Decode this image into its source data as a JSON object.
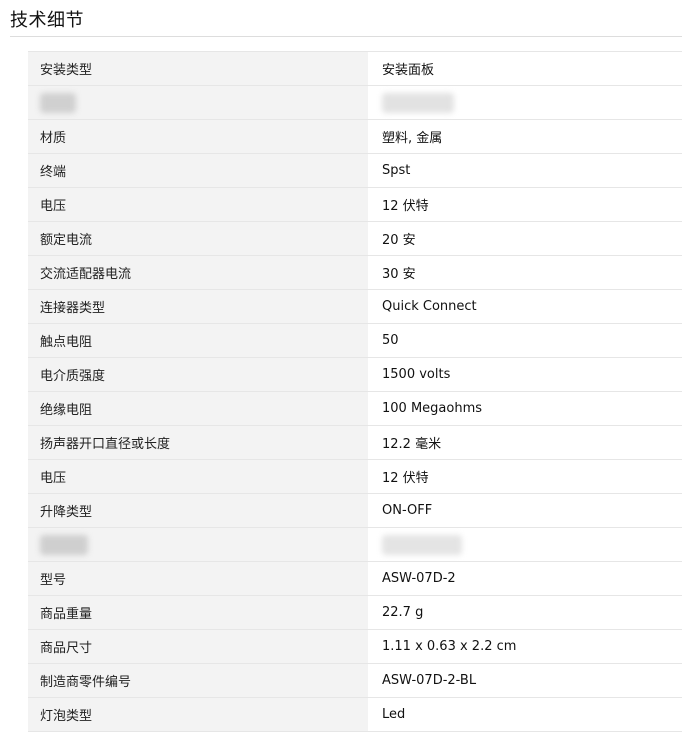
{
  "section": {
    "title": "技术细节"
  },
  "rows": [
    {
      "key": "安装类型",
      "value": "安装面板"
    },
    {
      "key": "",
      "value": "",
      "redacted": true
    },
    {
      "key": "材质",
      "value": "塑料, 金属"
    },
    {
      "key": "终端",
      "value": "Spst"
    },
    {
      "key": "电压",
      "value": "12 伏特"
    },
    {
      "key": "额定电流",
      "value": "20 安"
    },
    {
      "key": "交流适配器电流",
      "value": "30 安"
    },
    {
      "key": "连接器类型",
      "value": "Quick Connect"
    },
    {
      "key": "触点电阻",
      "value": "50"
    },
    {
      "key": "电介质强度",
      "value": "1500 volts"
    },
    {
      "key": "绝缘电阻",
      "value": "100 Megaohms"
    },
    {
      "key": "扬声器开口直径或长度",
      "value": "12.2 毫米"
    },
    {
      "key": "电压",
      "value": "12 伏特"
    },
    {
      "key": "升降类型",
      "value": "ON-OFF"
    },
    {
      "key": "",
      "value": "",
      "redacted": true
    },
    {
      "key": "型号",
      "value": "ASW-07D-2"
    },
    {
      "key": "商品重量",
      "value": "22.7 g"
    },
    {
      "key": "商品尺寸",
      "value": "1.11 x 0.63 x 2.2 cm"
    },
    {
      "key": "制造商零件编号",
      "value": "ASW-07D-2-BL"
    },
    {
      "key": "灯泡类型",
      "value": "Led"
    }
  ]
}
